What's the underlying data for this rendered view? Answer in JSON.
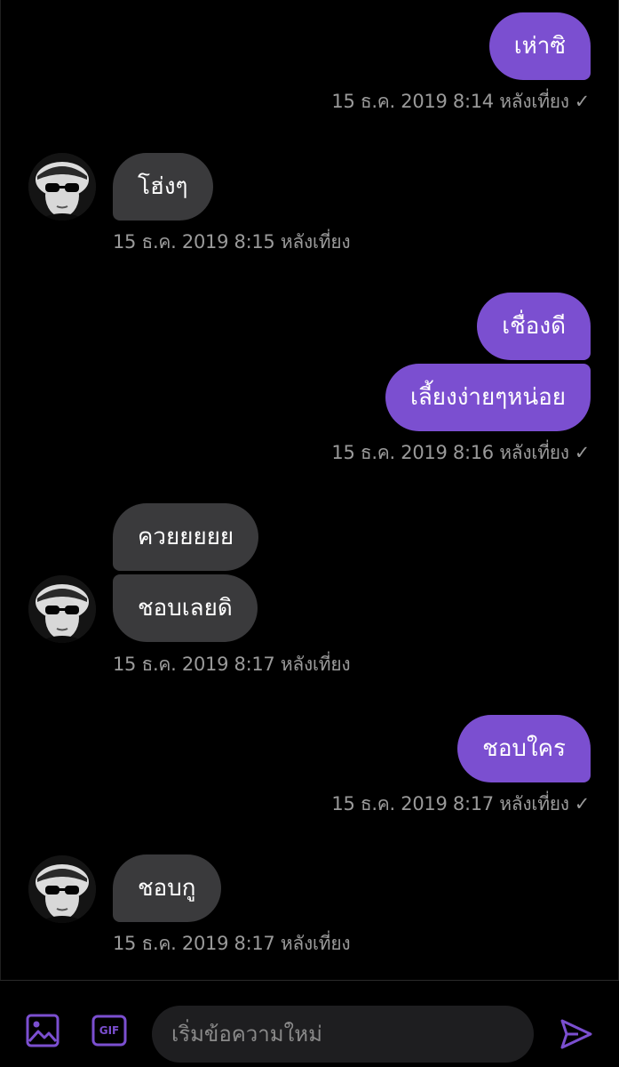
{
  "messages": [
    {
      "side": "sent",
      "text": "เห่าซิ"
    },
    {
      "side": "sent_ts",
      "text": "15 ธ.ค. 2019 8:14 หลังเที่ยง"
    },
    {
      "side": "recv",
      "text": "โฮ่งๆ"
    },
    {
      "side": "recv_ts",
      "text": "15 ธ.ค. 2019 8:15 หลังเที่ยง"
    },
    {
      "side": "sent",
      "text": "เชื่องดี"
    },
    {
      "side": "sent",
      "text": "เลี้ยงง่ายๆหน่อย"
    },
    {
      "side": "sent_ts",
      "text": "15 ธ.ค. 2019 8:16 หลังเที่ยง"
    },
    {
      "side": "recv",
      "text": "ควยยยยย"
    },
    {
      "side": "recv",
      "text": "ชอบเลยดิ"
    },
    {
      "side": "recv_ts",
      "text": "15 ธ.ค. 2019 8:17 หลังเที่ยง"
    },
    {
      "side": "sent",
      "text": "ชอบใคร"
    },
    {
      "side": "sent_ts",
      "text": "15 ธ.ค. 2019 8:17 หลังเที่ยง"
    },
    {
      "side": "recv",
      "text": "ชอบกู"
    },
    {
      "side": "recv_ts",
      "text": "15 ธ.ค. 2019 8:17 หลังเที่ยง"
    }
  ],
  "read_receipt": "✓",
  "composer": {
    "placeholder": "เริ่มข้อความใหม่",
    "gif_label": "GIF",
    "image_icon": "image-icon",
    "send_icon": "send-icon"
  },
  "colors": {
    "sent_bubble": "#7b4fd0",
    "received_bubble": "#3a3a3c",
    "accent": "#7b4fd0",
    "timestamp": "#9a9a9a",
    "background": "#000000"
  }
}
